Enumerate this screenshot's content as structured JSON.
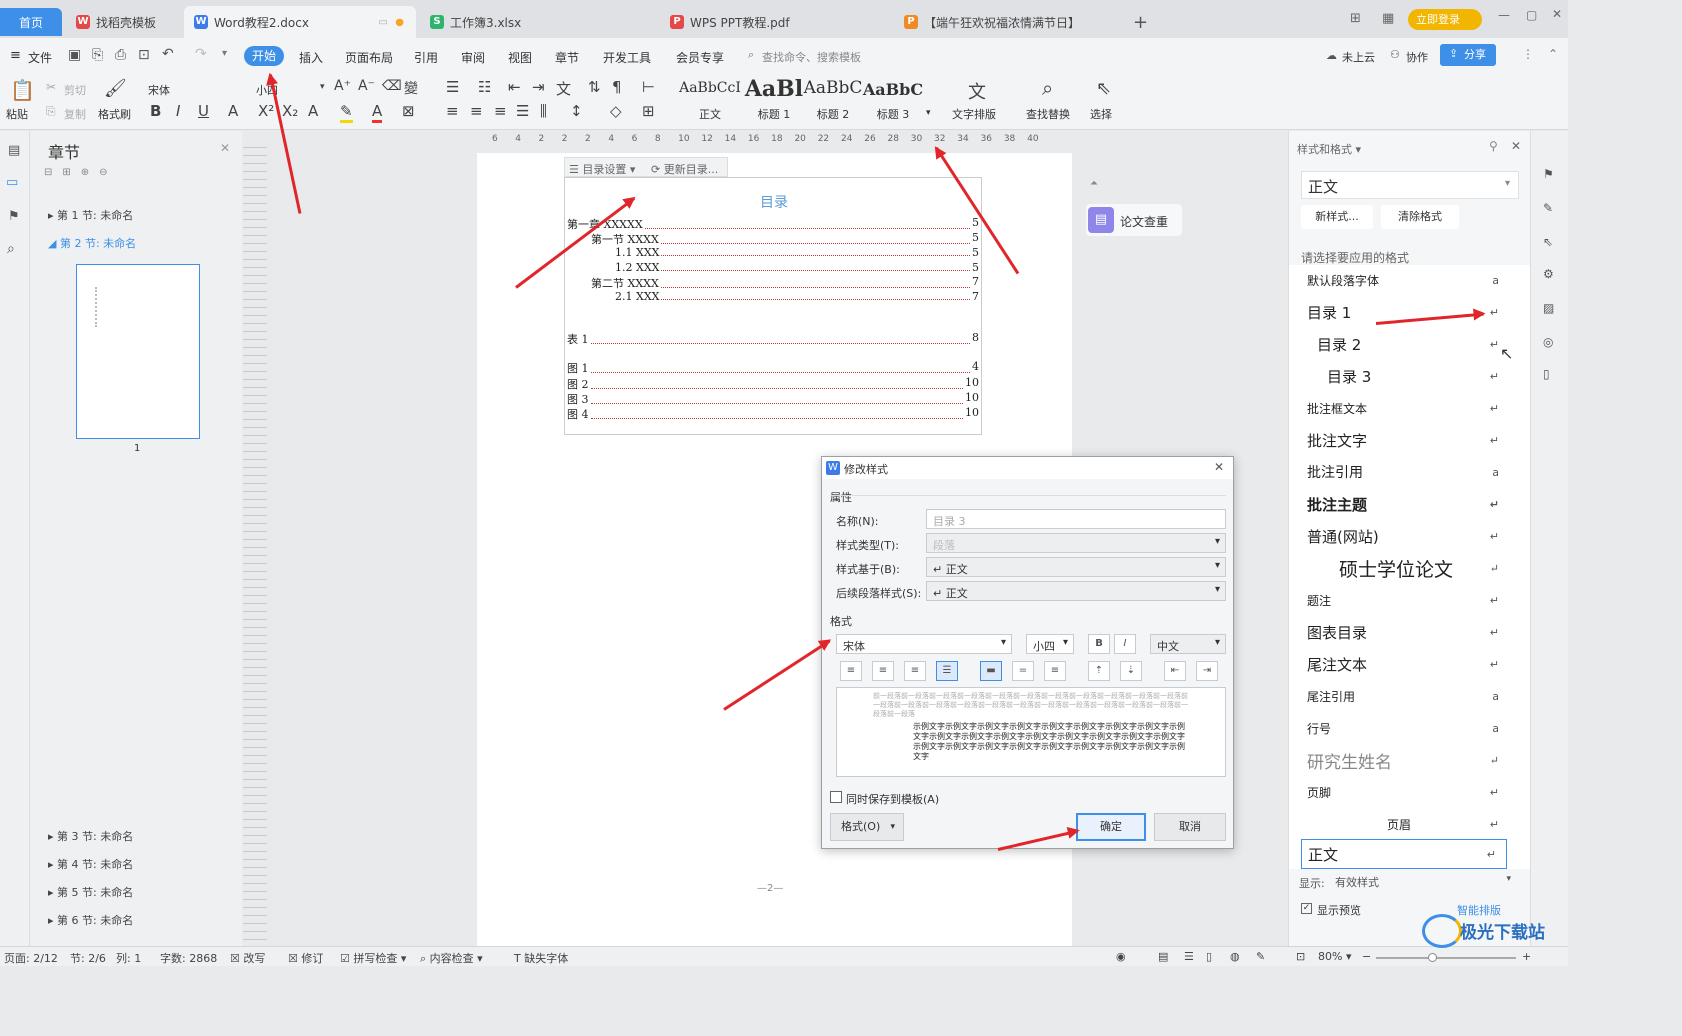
{
  "tabs": {
    "home": "首页",
    "t1": "找稻壳模板",
    "t2": "Word教程2.docx",
    "t3": "工作簿3.xlsx",
    "t4": "WPS PPT教程.pdf",
    "t5": "【端午狂欢祝福浓情满节日】",
    "login": "立即登录"
  },
  "menu": {
    "file": "文件",
    "start": "开始",
    "insert": "插入",
    "layout": "页面布局",
    "ref": "引用",
    "review": "审阅",
    "view": "视图",
    "chapter": "章节",
    "dev": "开发工具",
    "member": "会员专享",
    "search": "查找命令、搜索模板",
    "cloud": "未上云",
    "collab": "协作",
    "share": "分享"
  },
  "ribbon": {
    "paste": "粘贴",
    "cut": "剪切",
    "copy": "复制",
    "painter": "格式刷",
    "font": "宋体",
    "size": "小四",
    "styles": [
      {
        "preview": "AaBbCcI",
        "name": "正文"
      },
      {
        "preview": "AaBl",
        "name": "标题 1"
      },
      {
        "preview": "AaBbC",
        "name": "标题 2"
      },
      {
        "preview": "AaBbC",
        "name": "标题 3"
      }
    ],
    "typeset": "文字排版",
    "find": "查找替换",
    "select": "选择"
  },
  "chapters": {
    "title": "章节",
    "items": [
      "第 1 节: 未命名",
      "第 2 节: 未命名"
    ],
    "more": [
      "第 3 节: 未命名",
      "第 4 节: 未命名",
      "第 5 节: 未命名",
      "第 6 节: 未命名"
    ],
    "thumb_page": "1"
  },
  "ruler": {
    "ticks": [
      "6",
      "4",
      "2",
      "2",
      "2",
      "4",
      "6",
      "8",
      "10",
      "12",
      "14",
      "16",
      "18",
      "20",
      "22",
      "24",
      "26",
      "28",
      "30",
      "32",
      "34",
      "36",
      "38",
      "40"
    ]
  },
  "toc": {
    "settings": "目录设置",
    "update": "更新目录...",
    "heading": "目录",
    "lines": [
      {
        "label": "第一章 XXXXX",
        "page": "5"
      },
      {
        "label": "第一节 XXXX",
        "page": "5"
      },
      {
        "label": "1.1 XXX",
        "page": "5"
      },
      {
        "label": "1.2 XXX",
        "page": "5"
      },
      {
        "label": "第二节 XXXX",
        "page": "7"
      },
      {
        "label": "2.1 XXX",
        "page": "7"
      }
    ],
    "table_label": "表 1",
    "table_page": "8",
    "figures": [
      {
        "label": "图 1",
        "page": "4"
      },
      {
        "label": "图 2",
        "page": "10"
      },
      {
        "label": "图 3",
        "page": "10"
      },
      {
        "label": "图 4",
        "page": "10"
      }
    ],
    "page_footer": "—2—"
  },
  "paper_check": "论文查重",
  "stylepanel": {
    "title": "样式和格式",
    "current": "正文",
    "new_style": "新样式...",
    "clear": "清除格式",
    "hint": "请选择要应用的格式",
    "items": [
      {
        "name": "默认段落字体",
        "mark": "a"
      },
      {
        "name": "目录  1",
        "mark": "↵"
      },
      {
        "name": "目录  2",
        "mark": "↵"
      },
      {
        "name": "目录  3",
        "mark": "↵"
      },
      {
        "name": "批注框文本",
        "mark": "↵"
      },
      {
        "name": "批注文字",
        "mark": "↵"
      },
      {
        "name": "批注引用",
        "mark": "a"
      },
      {
        "name": "批注主题",
        "mark": "↵"
      },
      {
        "name": "普通(网站)",
        "mark": "↵"
      },
      {
        "name": "硕士学位论文",
        "mark": "↵"
      },
      {
        "name": "题注",
        "mark": "↵"
      },
      {
        "name": "图表目录",
        "mark": "↵"
      },
      {
        "name": "尾注文本",
        "mark": "↵"
      },
      {
        "name": "尾注引用",
        "mark": "a"
      },
      {
        "name": "行号",
        "mark": "a"
      },
      {
        "name": "研究生姓名",
        "mark": "↵"
      },
      {
        "name": "页脚",
        "mark": "↵"
      },
      {
        "name": "页眉",
        "mark": "↵"
      },
      {
        "name": "正文",
        "mark": "↵"
      }
    ],
    "show_label": "显示:",
    "show_value": "有效样式",
    "preview_label": "显示预览",
    "smart": "智能排版"
  },
  "dialog": {
    "title": "修改样式",
    "props": "属性",
    "name_label": "名称(N):",
    "name_value": "目录 3",
    "type_label": "样式类型(T):",
    "type_value": "段落",
    "based_label": "样式基于(B):",
    "based_value": "↵ 正文",
    "next_label": "后续段落样式(S):",
    "next_value": "↵ 正文",
    "format": "格式",
    "font": "宋体",
    "size": "小四",
    "lang": "中文",
    "preview_prev": "前一段落前一段落前一段落前一段落前一段落前一段落前一段落前一段落前一段落前一段落前一段落前一段落前一段落前一段落前一段落前一段落前一段落前一段落前一段落前一段落前一段落前一段落前一段落前一段落",
    "preview_sample": "示例文字示例文字示例文字示例文字示例文字示例文字示例文字示例文字示例文字示例文字示例文字示例文字示例文字示例文字示例文字示例文字示例文字示例文字示例文字示例文字示例文字示例文字示例文字示例文字示例文字示例文字",
    "save_template": "同时保存到模板(A)",
    "format_btn": "格式(O)",
    "ok": "确定",
    "cancel": "取消"
  },
  "status": {
    "page": "页面: 2/12",
    "section": "节: 2/6",
    "col": "列: 1",
    "words": "字数: 2868",
    "overwrite": "改写",
    "revise": "修订",
    "spell": "拼写检查",
    "content": "内容检查",
    "missing_font": "缺失字体",
    "zoom": "80%"
  },
  "watermark": "极光下载站"
}
